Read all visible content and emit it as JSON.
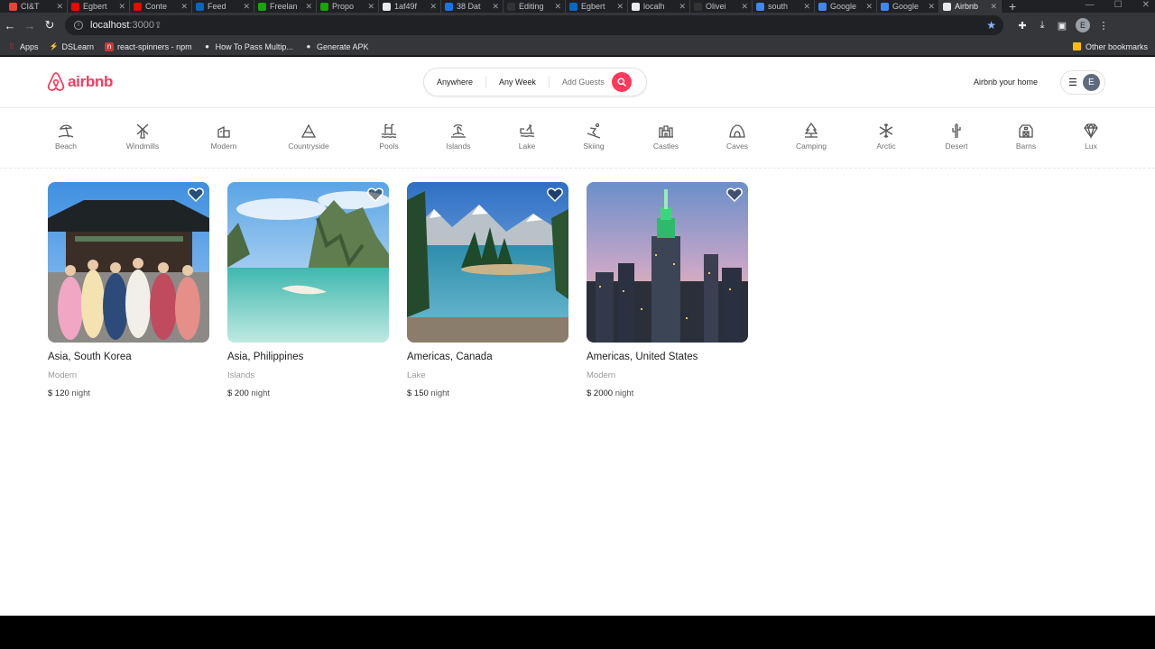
{
  "browser": {
    "tabs": [
      {
        "label": "CI&T",
        "color": "#ea4335",
        "active": false
      },
      {
        "label": "Egbert",
        "color": "#ff0000",
        "active": false
      },
      {
        "label": "Conte",
        "color": "#ff0000",
        "active": false
      },
      {
        "label": "Feed",
        "color": "#0a66c2",
        "active": false
      },
      {
        "label": "Freelan",
        "color": "#14a800",
        "active": false
      },
      {
        "label": "Propo",
        "color": "#14a800",
        "active": false
      },
      {
        "label": "1af49f",
        "color": "#e8eaed",
        "active": false
      },
      {
        "label": "38 Dat",
        "color": "#1a73e8",
        "active": false
      },
      {
        "label": "Editing",
        "color": "#333333",
        "active": false
      },
      {
        "label": "Egbert",
        "color": "#0a66c2",
        "active": false
      },
      {
        "label": "localh",
        "color": "#e8eaed",
        "active": false
      },
      {
        "label": "Olivei",
        "color": "#333333",
        "active": false
      },
      {
        "label": "south",
        "color": "#4285f4",
        "active": false
      },
      {
        "label": "Google",
        "color": "#4285f4",
        "active": false
      },
      {
        "label": "Google",
        "color": "#4285f4",
        "active": false
      },
      {
        "label": "Airbnb",
        "color": "#e8eaed",
        "active": true
      }
    ],
    "new_tab": "+",
    "address": {
      "host": "localhost",
      "port": ":3000"
    },
    "profile_initial": "E",
    "bookmarks": [
      {
        "label": "Apps",
        "color": "#ea4335"
      },
      {
        "label": "DSLearn",
        "color": "#fbbc04"
      },
      {
        "label": "react-spinners - npm",
        "color": "#cb3837"
      },
      {
        "label": "How To Pass Multip...",
        "color": "#e8eaed"
      },
      {
        "label": "Generate APK",
        "color": "#e8eaed"
      }
    ],
    "other_bookmarks": "Other bookmarks"
  },
  "header": {
    "logo_text": "airbnb",
    "search": {
      "anywhere": "Anywhere",
      "week": "Any Week",
      "guests": "Add Guests"
    },
    "host_link": "Airbnb your home",
    "avatar_initial": "E"
  },
  "categories": [
    {
      "label": "Beach",
      "icon": "beach-icon"
    },
    {
      "label": "Windmills",
      "icon": "windmill-icon"
    },
    {
      "label": "Modern",
      "icon": "modern-icon"
    },
    {
      "label": "Countryside",
      "icon": "countryside-icon"
    },
    {
      "label": "Pools",
      "icon": "pool-icon"
    },
    {
      "label": "Islands",
      "icon": "island-icon"
    },
    {
      "label": "Lake",
      "icon": "lake-icon"
    },
    {
      "label": "Skiing",
      "icon": "skiing-icon"
    },
    {
      "label": "Castles",
      "icon": "castle-icon"
    },
    {
      "label": "Caves",
      "icon": "cave-icon"
    },
    {
      "label": "Camping",
      "icon": "camping-icon"
    },
    {
      "label": "Arctic",
      "icon": "snowflake-icon"
    },
    {
      "label": "Desert",
      "icon": "cactus-icon"
    },
    {
      "label": "Barns",
      "icon": "barn-icon"
    },
    {
      "label": "Lux",
      "icon": "diamond-icon"
    }
  ],
  "listings": [
    {
      "location": "Asia, South Korea",
      "category": "Modern",
      "price": "$ 120",
      "unit": "night"
    },
    {
      "location": "Asia, Philippines",
      "category": "Islands",
      "price": "$ 200",
      "unit": "night"
    },
    {
      "location": "Americas, Canada",
      "category": "Lake",
      "price": "$ 150",
      "unit": "night"
    },
    {
      "location": "Americas, United States",
      "category": "Modern",
      "price": "$ 2000",
      "unit": "night"
    }
  ]
}
